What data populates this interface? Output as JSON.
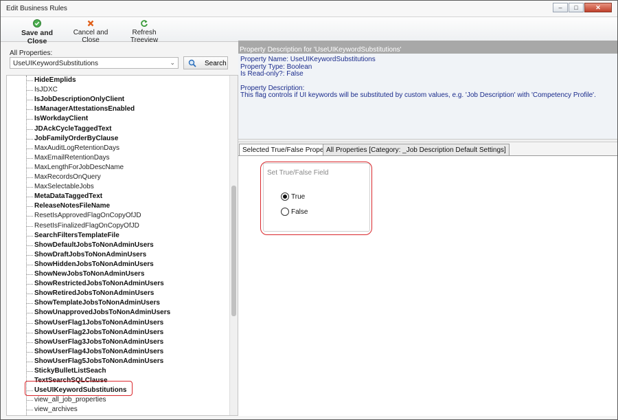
{
  "window": {
    "title": "Edit Business Rules"
  },
  "toolbar": {
    "save_close": "Save and Close",
    "cancel_close": "Cancel and Close",
    "refresh": "Refresh Treeview"
  },
  "properties": {
    "label": "All Properties:",
    "selected": "UseUIKeywordSubstitutions",
    "search_label": "Search"
  },
  "tree": {
    "items": [
      {
        "label": "HideEmplids",
        "bold": true
      },
      {
        "label": "IsJDXC",
        "bold": false
      },
      {
        "label": "IsJobDescriptionOnlyClient",
        "bold": true
      },
      {
        "label": "IsManagerAttestationsEnabled",
        "bold": true
      },
      {
        "label": "IsWorkdayClient",
        "bold": true
      },
      {
        "label": "JDAckCycleTaggedText",
        "bold": true
      },
      {
        "label": "JobFamilyOrderByClause",
        "bold": true
      },
      {
        "label": "MaxAuditLogRetentionDays",
        "bold": false
      },
      {
        "label": "MaxEmailRetentionDays",
        "bold": false
      },
      {
        "label": "MaxLengthForJobDescName",
        "bold": false
      },
      {
        "label": "MaxRecordsOnQuery",
        "bold": false
      },
      {
        "label": "MaxSelectableJobs",
        "bold": false
      },
      {
        "label": "MetaDataTaggedText",
        "bold": true
      },
      {
        "label": "ReleaseNotesFileName",
        "bold": true
      },
      {
        "label": "ResetIsApprovedFlagOnCopyOfJD",
        "bold": false
      },
      {
        "label": "ResetIsFinalizedFlagOnCopyOfJD",
        "bold": false
      },
      {
        "label": "SearchFiltersTemplateFile",
        "bold": true
      },
      {
        "label": "ShowDefaultJobsToNonAdminUsers",
        "bold": true
      },
      {
        "label": "ShowDraftJobsToNonAdminUsers",
        "bold": true
      },
      {
        "label": "ShowHiddenJobsToNonAdminUsers",
        "bold": true
      },
      {
        "label": "ShowNewJobsToNonAdminUsers",
        "bold": true
      },
      {
        "label": "ShowRestrictedJobsToNonAdminUsers",
        "bold": true
      },
      {
        "label": "ShowRetiredJobsToNonAdminUsers",
        "bold": true
      },
      {
        "label": "ShowTemplateJobsToNonAdminUsers",
        "bold": true
      },
      {
        "label": "ShowUnapprovedJobsToNonAdminUsers",
        "bold": true
      },
      {
        "label": "ShowUserFlag1JobsToNonAdminUsers",
        "bold": true
      },
      {
        "label": "ShowUserFlag2JobsToNonAdminUsers",
        "bold": true
      },
      {
        "label": "ShowUserFlag3JobsToNonAdminUsers",
        "bold": true
      },
      {
        "label": "ShowUserFlag4JobsToNonAdminUsers",
        "bold": true
      },
      {
        "label": "ShowUserFlag5JobsToNonAdminUsers",
        "bold": true
      },
      {
        "label": "StickyBulletListSeach",
        "bold": true
      },
      {
        "label": "TextSearchSQLClause",
        "bold": true
      },
      {
        "label": "UseUIKeywordSubstitutions",
        "bold": true
      },
      {
        "label": "view_all_job_properties",
        "bold": false
      },
      {
        "label": "view_archives",
        "bold": false
      }
    ]
  },
  "description": {
    "header": "Property Description for 'UseUIKeywordSubstitutions'",
    "name_line": "Property Name: UseUIKeywordSubstitutions",
    "type_line": "Property Type: Boolean",
    "readonly_line": "Is Read-only?: False",
    "desc_label": "Property Description:",
    "desc_text": "This flag controls if UI keywords will be substituted by custom values, e.g. 'Job Description' with 'Competency Profile'."
  },
  "tabs": {
    "tab1": "Selected True/False Property",
    "tab2": "All Properties [Category: _Job Description Default Settings]"
  },
  "field": {
    "group_title": "Set True/False Field",
    "true_label": "True",
    "false_label": "False",
    "value": true
  }
}
